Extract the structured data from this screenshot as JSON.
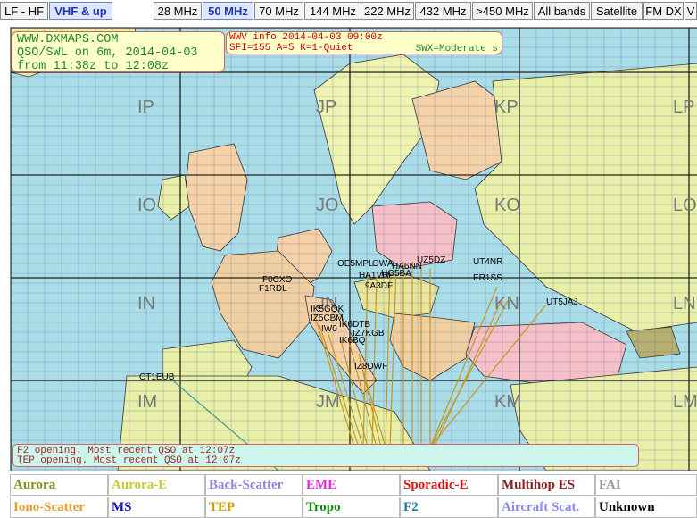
{
  "tabs": [
    {
      "label": "LF - HF",
      "active": false
    },
    {
      "label": "VHF & up",
      "active": true
    },
    {
      "label": "28 MHz",
      "active": false
    },
    {
      "label": "50 MHz",
      "active": true
    },
    {
      "label": "70 MHz",
      "active": false
    },
    {
      "label": "144 MHz",
      "active": false
    },
    {
      "label": "222 MHz",
      "active": false
    },
    {
      "label": "432 MHz",
      "active": false
    },
    {
      "label": ">450 MHz",
      "active": false
    },
    {
      "label": "All bands",
      "active": false
    },
    {
      "label": "Satellite",
      "active": false
    },
    {
      "label": "FM DX",
      "active": false
    },
    {
      "label": "V",
      "active": false
    }
  ],
  "brand_box": {
    "site": "WWW.DXMAPS.COM",
    "line2": "QSO/SWL on 6m, 2014-04-03",
    "line3": "from 11:38z to 12:08z"
  },
  "wwv_box": {
    "line1": "WWV info 2014-04-03 09:00z",
    "line2": "SFI=155  A=5  K=1-Quiet",
    "swx": "SWX=Moderate s"
  },
  "grid_labels": [
    "IP",
    "JP",
    "KP",
    "LP",
    "IO",
    "JO",
    "KO",
    "LO",
    "IN",
    "JN",
    "KN",
    "LN",
    "IM",
    "JM",
    "KM",
    "LM"
  ],
  "stations": [
    "F0CXO",
    "F1RDL",
    "OE5MPL",
    "OWA",
    "HA6NN",
    "HA1VHF",
    "HG5BA",
    "UZ5DZ",
    "UT4NR",
    "ER1SS",
    "UT5JAJ",
    "9A3DF",
    "IK5GQK",
    "IZ5CBM",
    "IW0",
    "IK6DTB",
    "IZ7KGB",
    "IK6BQ",
    "IZ8DWF",
    "CT1EUB"
  ],
  "status_lines": [
    "F2 opening. Most recent QSO at 12:07z",
    "TEP opening. Most recent QSO at 12:07z"
  ],
  "legend": [
    {
      "label": "Aurora",
      "color": "#8b8b1a",
      "bold": true
    },
    {
      "label": "Aurora-E",
      "color": "#c9c930",
      "bold": true
    },
    {
      "label": "Back-Scatter",
      "color": "#8a8ae6",
      "bold": true
    },
    {
      "label": "EME",
      "color": "#ee22ee",
      "bold": true
    },
    {
      "label": "Sporadic-E",
      "color": "#dd1111",
      "bold": true
    },
    {
      "label": "Multihop ES",
      "color": "#882222",
      "bold": true
    },
    {
      "label": "FAI",
      "color": "#999999",
      "bold": true
    },
    {
      "label": "Iono-Scatter",
      "color": "#e0a030",
      "bold": true
    },
    {
      "label": "MS",
      "color": "#1111bb",
      "bold": true
    },
    {
      "label": "TEP",
      "color": "#c8a000",
      "bold": true
    },
    {
      "label": "Tropo",
      "color": "#118811",
      "bold": true
    },
    {
      "label": "F2",
      "color": "#2277aa",
      "bold": true
    },
    {
      "label": "Aircraft Scat.",
      "color": "#8888ee",
      "bold": true
    },
    {
      "label": "Unknown",
      "color": "#000000",
      "bold": true
    }
  ],
  "colors": {
    "sea": "#a9dde8",
    "tep_path": "#c8961e",
    "f2_path": "#2a8b8b",
    "grid_line": "#444444"
  }
}
